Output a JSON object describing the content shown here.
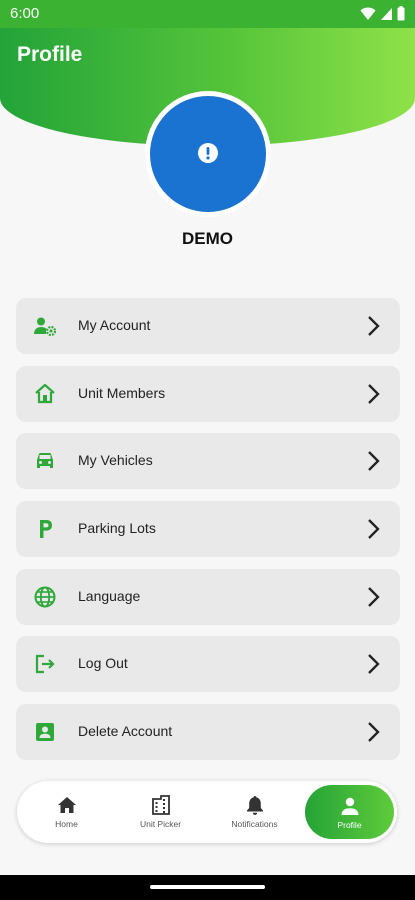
{
  "status_bar": {
    "time": "6:00"
  },
  "header": {
    "title": "Profile"
  },
  "profile": {
    "name": "DEMO"
  },
  "menu": [
    {
      "label": "My Account",
      "icon": "account-settings-icon"
    },
    {
      "label": "Unit Members",
      "icon": "home-icon"
    },
    {
      "label": "My Vehicles",
      "icon": "car-icon"
    },
    {
      "label": "Parking Lots",
      "icon": "parking-icon"
    },
    {
      "label": "Language",
      "icon": "globe-icon"
    },
    {
      "label": "Log Out",
      "icon": "logout-icon"
    },
    {
      "label": "Delete Account",
      "icon": "person-box-icon"
    }
  ],
  "bottom_nav": [
    {
      "label": "Home",
      "icon": "home-icon"
    },
    {
      "label": "Unit Picker",
      "icon": "building-icon"
    },
    {
      "label": "Notifications",
      "icon": "bell-icon"
    },
    {
      "label": "Profile",
      "icon": "person-icon",
      "active": true
    }
  ],
  "colors": {
    "accent_green": "#2fa83a",
    "avatar_blue": "#1a73d0",
    "menu_background": "#e9e9e9"
  }
}
